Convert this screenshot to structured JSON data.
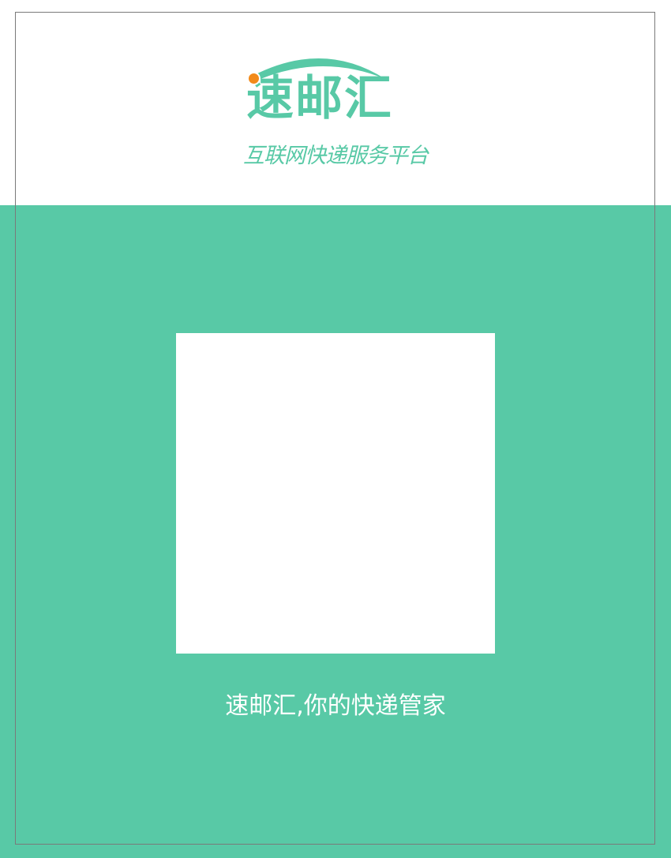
{
  "brand": {
    "name": "速邮汇",
    "tagline": "互联网快递服务平台",
    "logo_icon": "orange-dot-arc-logo"
  },
  "qr": {
    "icon": "qr-code-placeholder"
  },
  "footer": {
    "slogan": "速邮汇,你的快递管家"
  },
  "colors": {
    "accent": "#58c9a6",
    "dot": "#f28a1a",
    "background": "#ffffff",
    "frame": "#7a7a7a"
  }
}
